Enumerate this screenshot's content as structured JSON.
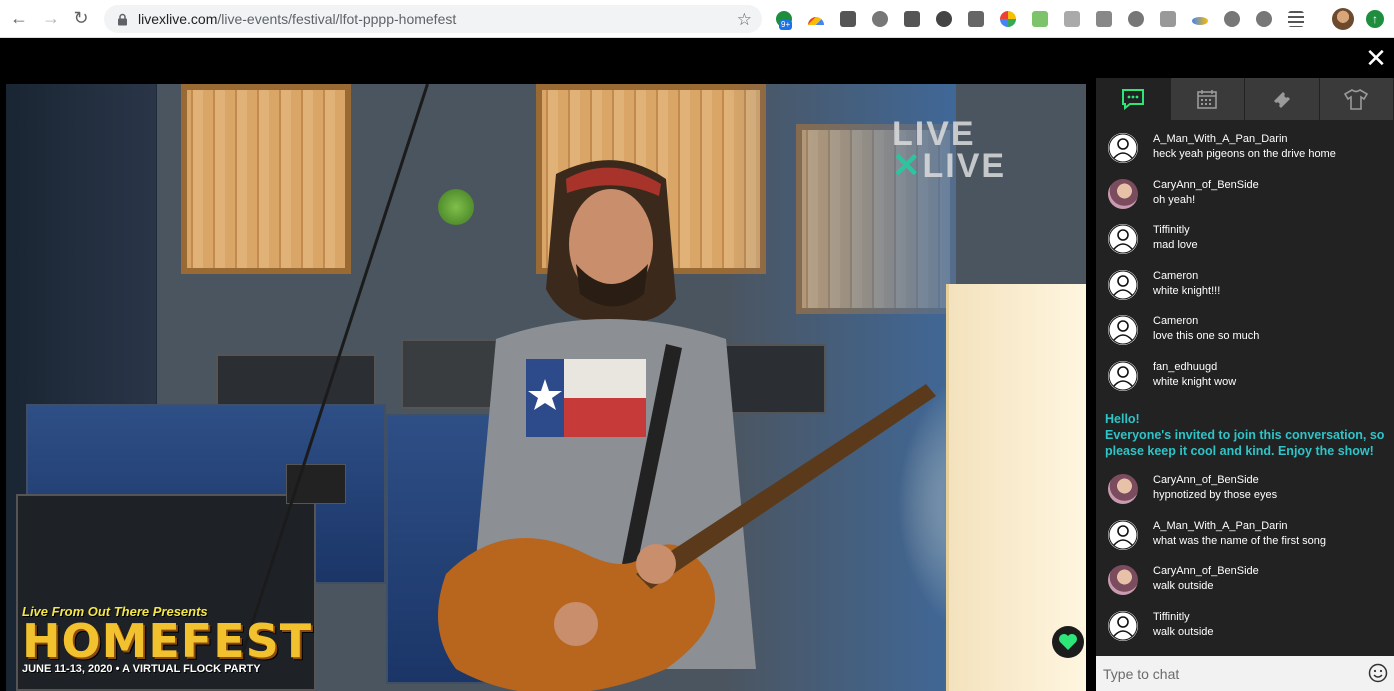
{
  "browser": {
    "url_host": "livexlive.com",
    "url_path": "/live-events/festival/lfot-pppp-homefest",
    "ext_badge": "9+"
  },
  "video": {
    "logo_line1": "LIVE",
    "logo_line2": "LIVE",
    "fest_top": "Live From Out There Presents",
    "fest_main": "HOMEFEST",
    "fest_sub": "JUNE 11-13, 2020 • A VIRTUAL FLOCK PARTY"
  },
  "sidebar": {
    "tabs": [
      "chat",
      "schedule",
      "tickets",
      "merch"
    ],
    "messages_top": [
      {
        "user": "A_Man_With_A_Pan_Darin",
        "text": "heck yeah pigeons on the drive home",
        "photo": false
      },
      {
        "user": "CaryAnn_of_BenSide",
        "text": "oh yeah!",
        "photo": true
      },
      {
        "user": "Tiffinitly",
        "text": "mad love",
        "photo": false
      },
      {
        "user": "Cameron",
        "text": "white knight!!!",
        "photo": false
      },
      {
        "user": "Cameron",
        "text": "love this one so much",
        "photo": false
      },
      {
        "user": "fan_edhuugd",
        "text": "white knight wow",
        "photo": false
      }
    ],
    "notice_title": "Hello!",
    "notice_body": "Everyone's invited to join this conversation, so please keep it cool and kind. Enjoy the show!",
    "messages_bottom": [
      {
        "user": "CaryAnn_of_BenSide",
        "text": "hypnotized by those eyes",
        "photo": true
      },
      {
        "user": "A_Man_With_A_Pan_Darin",
        "text": "what was the name of the first song",
        "photo": false
      },
      {
        "user": "CaryAnn_of_BenSide",
        "text": "walk outside",
        "photo": true
      },
      {
        "user": "Tiffinitly",
        "text": "walk outside",
        "photo": false
      }
    ],
    "chat_placeholder": "Type to chat"
  },
  "colors": {
    "accent": "#2ec4c8",
    "heart": "#2ee57a",
    "sidebar_bg": "#222222"
  }
}
